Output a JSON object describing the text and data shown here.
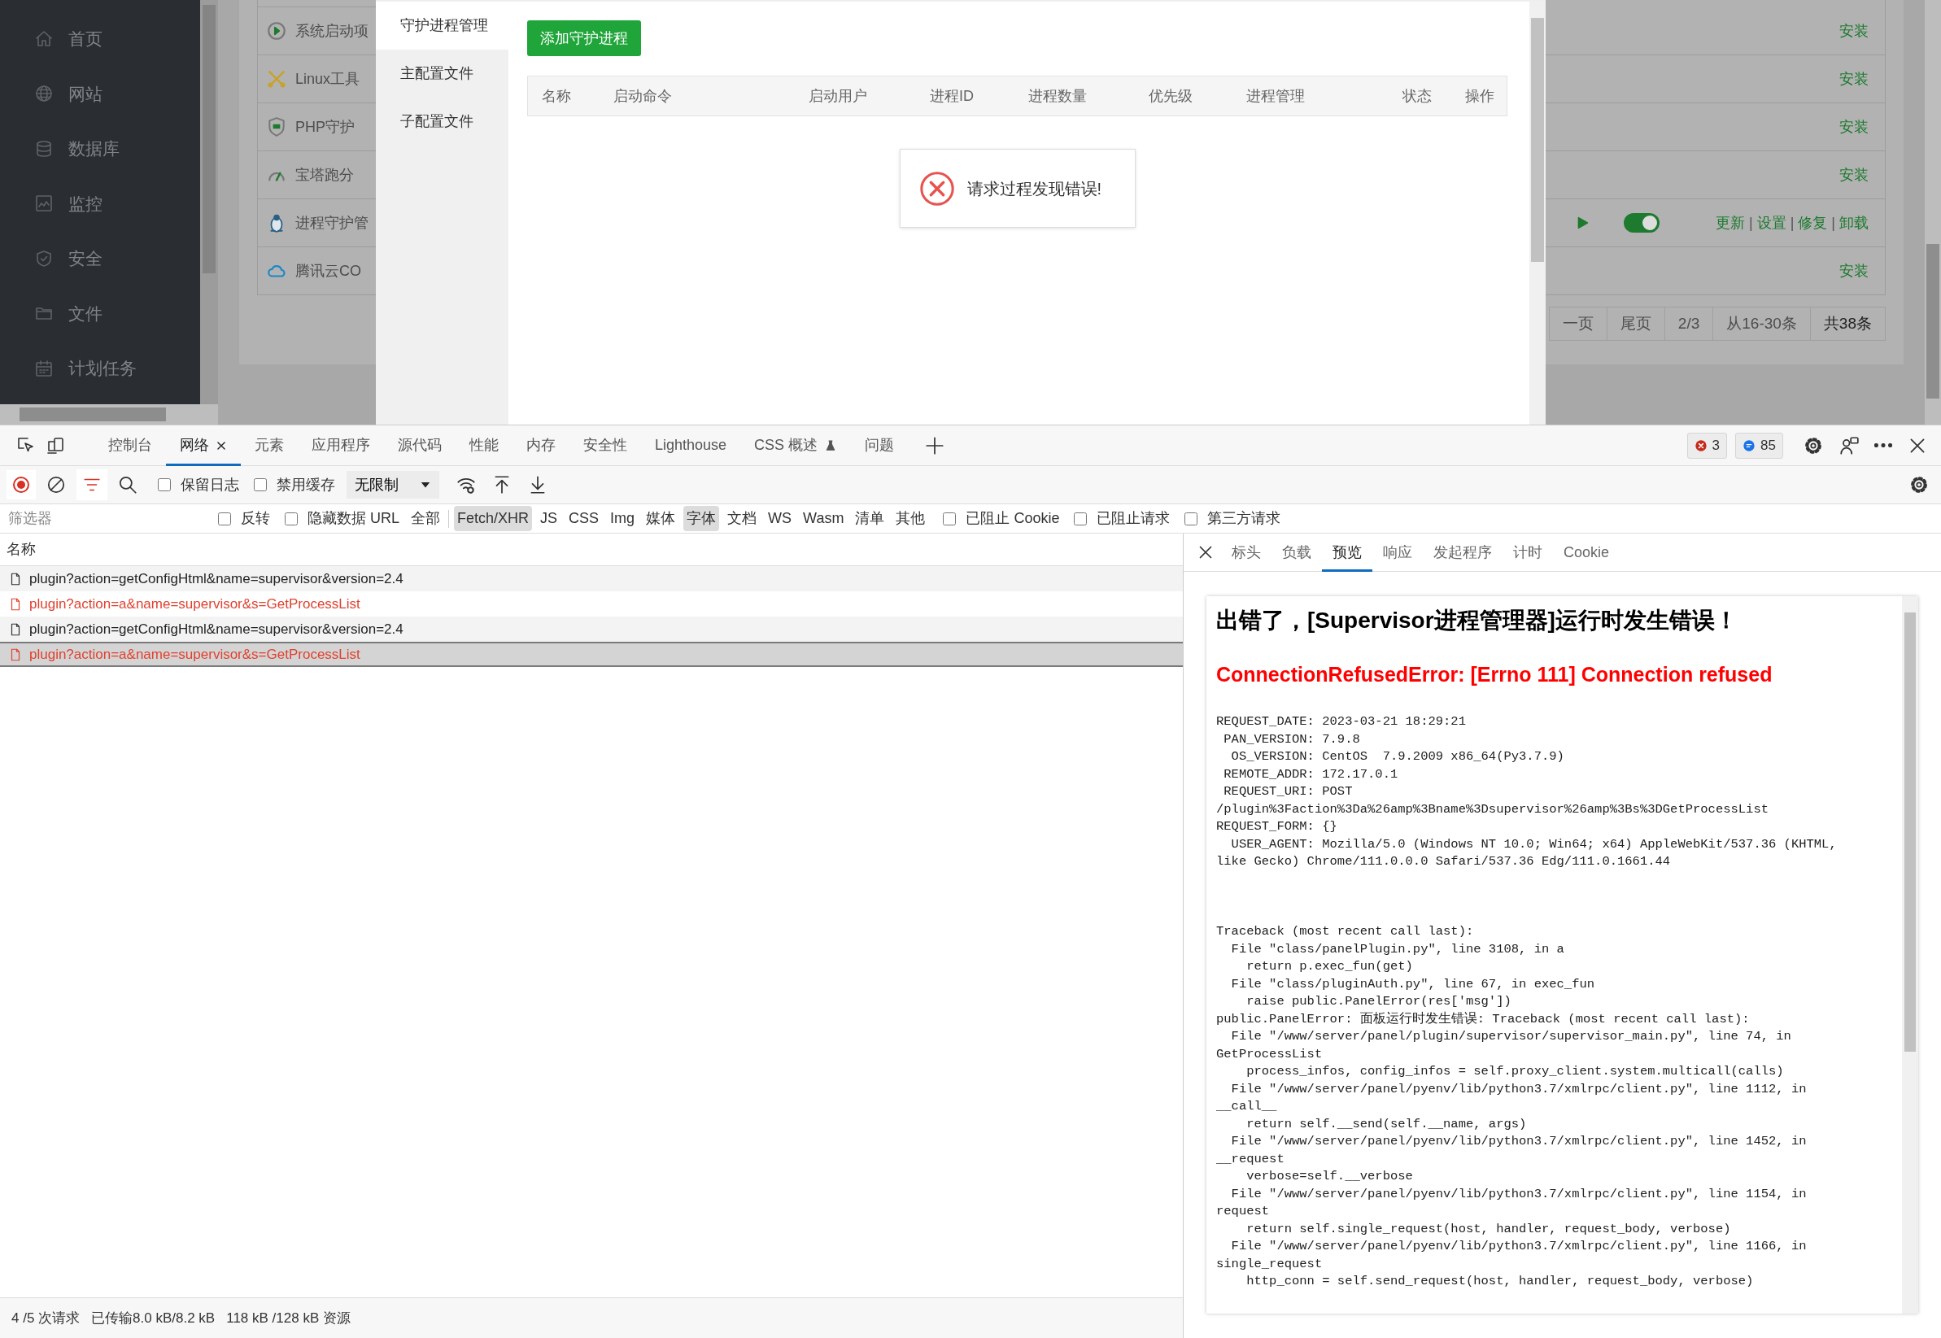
{
  "sidebar": {
    "items": [
      {
        "label": "首页"
      },
      {
        "label": "网站"
      },
      {
        "label": "数据库"
      },
      {
        "label": "监控"
      },
      {
        "label": "安全"
      },
      {
        "label": "文件"
      },
      {
        "label": "计划任务"
      }
    ]
  },
  "plugin_list": {
    "rows": [
      {
        "name": "系统启动项"
      },
      {
        "name": "Linux工具"
      },
      {
        "name": "PHP守护"
      },
      {
        "name": "宝塔跑分"
      },
      {
        "name": "进程守护管"
      },
      {
        "name": "腾讯云CO"
      }
    ]
  },
  "dialog": {
    "tabs": [
      {
        "label": "守护进程管理",
        "selected": true
      },
      {
        "label": "主配置文件",
        "selected": false
      },
      {
        "label": "子配置文件",
        "selected": false
      }
    ],
    "add_button": "添加守护进程",
    "table": {
      "columns": [
        "名称",
        "启动命令",
        "启动用户",
        "进程ID",
        "进程数量",
        "优先级",
        "进程管理",
        "状态",
        "操作"
      ]
    },
    "toast": "请求过程发现错误!"
  },
  "plugin_table": {
    "separator": "|",
    "rows": [
      {
        "kind": "install",
        "action": "安装"
      },
      {
        "kind": "install",
        "action": "安装"
      },
      {
        "kind": "install",
        "action": "安装"
      },
      {
        "kind": "install",
        "action": "安装"
      },
      {
        "kind": "installed",
        "enabled": true,
        "actions": [
          "更新",
          "设置",
          "修复",
          "卸载"
        ]
      },
      {
        "kind": "install",
        "action": "安装"
      }
    ],
    "pager": [
      "一页",
      "尾页",
      "2/3",
      "从16-30条",
      "共38条"
    ]
  },
  "devtools": {
    "tabs": [
      {
        "label": "控制台",
        "selected": false,
        "experimental": false
      },
      {
        "label": "网络",
        "selected": true,
        "experimental": false
      },
      {
        "label": "元素",
        "selected": false,
        "experimental": false
      },
      {
        "label": "应用程序",
        "selected": false,
        "experimental": false
      },
      {
        "label": "源代码",
        "selected": false,
        "experimental": false
      },
      {
        "label": "性能",
        "selected": false,
        "experimental": false
      },
      {
        "label": "内存",
        "selected": false,
        "experimental": false
      },
      {
        "label": "安全性",
        "selected": false,
        "experimental": false
      },
      {
        "label": "Lighthouse",
        "selected": false,
        "experimental": false
      },
      {
        "label": "CSS 概述",
        "selected": false,
        "experimental": true
      },
      {
        "label": "问题",
        "selected": false,
        "experimental": false
      }
    ],
    "errors": "3",
    "messages": "85",
    "toolbar": {
      "recording": true,
      "preserve_log": {
        "label": "保留日志",
        "checked": false
      },
      "disable_cache": {
        "label": "禁用缓存",
        "checked": false
      },
      "throttling": "无限制"
    },
    "filter_bar": {
      "placeholder": "筛选器",
      "invert": {
        "label": "反转",
        "checked": false
      },
      "hide_data_urls": {
        "label": "隐藏数据 URL",
        "checked": false
      },
      "types": [
        {
          "label": "全部",
          "selected": false
        },
        {
          "label": "Fetch/XHR",
          "selected": true
        },
        {
          "label": "JS",
          "selected": false
        },
        {
          "label": "CSS",
          "selected": false
        },
        {
          "label": "Img",
          "selected": false
        },
        {
          "label": "媒体",
          "selected": false
        },
        {
          "label": "字体",
          "selected": true
        },
        {
          "label": "文档",
          "selected": false
        },
        {
          "label": "WS",
          "selected": false
        },
        {
          "label": "Wasm",
          "selected": false
        },
        {
          "label": "清单",
          "selected": false
        },
        {
          "label": "其他",
          "selected": false
        }
      ],
      "blocked_cookies": {
        "label": "已阻止 Cookie",
        "checked": false
      },
      "blocked_requests": {
        "label": "已阻止请求",
        "checked": false
      },
      "third_party": {
        "label": "第三方请求",
        "checked": false
      }
    },
    "requests": {
      "header": "名称",
      "rows": [
        {
          "name": "plugin?action=getConfigHtml&name=supervisor&version=2.4",
          "failed": false,
          "selected": false
        },
        {
          "name": "plugin?action=a&name=supervisor&s=GetProcessList",
          "failed": true,
          "selected": false
        },
        {
          "name": "plugin?action=getConfigHtml&name=supervisor&version=2.4",
          "failed": false,
          "selected": false
        },
        {
          "name": "plugin?action=a&name=supervisor&s=GetProcessList",
          "failed": true,
          "selected": true
        }
      ]
    },
    "status_bar": {
      "requests": "4 /5 次请求",
      "transferred": "已传输8.0 kB/8.2 kB",
      "resources": "118 kB /128 kB 资源"
    },
    "detail": {
      "tabs": [
        {
          "label": "标头",
          "selected": false
        },
        {
          "label": "负载",
          "selected": false
        },
        {
          "label": "预览",
          "selected": true
        },
        {
          "label": "响应",
          "selected": false
        },
        {
          "label": "发起程序",
          "selected": false
        },
        {
          "label": "计时",
          "selected": false
        },
        {
          "label": "Cookie",
          "selected": false
        }
      ],
      "preview": {
        "title": "出错了，[Supervisor进程管理器]运行时发生错误！",
        "error": "ConnectionRefusedError: [Errno 111] Connection refused",
        "lines": [
          "REQUEST_DATE: 2023-03-21 18:29:21",
          " PAN_VERSION: 7.9.8",
          "  OS_VERSION: CentOS  7.9.2009 x86_64(Py3.7.9)",
          " REMOTE_ADDR: 172.17.0.1",
          " REQUEST_URI: POST",
          "/plugin%3Faction%3Da%26amp%3Bname%3Dsupervisor%26amp%3Bs%3DGetProcessList",
          "REQUEST_FORM: {}",
          "  USER_AGENT: Mozilla/5.0 (Windows NT 10.0; Win64; x64) AppleWebKit/537.36 (KHTML,",
          "like Gecko) Chrome/111.0.0.0 Safari/537.36 Edg/111.0.1661.44"
        ],
        "traceback": [
          "Traceback (most recent call last):",
          "  File \"class/panelPlugin.py\", line 3108, in a",
          "    return p.exec_fun(get)",
          "  File \"class/pluginAuth.py\", line 67, in exec_fun",
          "    raise public.PanelError(res['msg'])",
          "public.PanelError: 面板运行时发生错误: Traceback (most recent call last):",
          "  File \"/www/server/panel/plugin/supervisor/supervisor_main.py\", line 74, in",
          "GetProcessList",
          "    process_infos, config_infos = self.proxy_client.system.multicall(calls)",
          "  File \"/www/server/panel/pyenv/lib/python3.7/xmlrpc/client.py\", line 1112, in",
          "__call__",
          "    return self.__send(self.__name, args)",
          "  File \"/www/server/panel/pyenv/lib/python3.7/xmlrpc/client.py\", line 1452, in",
          "__request",
          "    verbose=self.__verbose",
          "  File \"/www/server/panel/pyenv/lib/python3.7/xmlrpc/client.py\", line 1154, in",
          "request",
          "    return self.single_request(host, handler, request_body, verbose)",
          "  File \"/www/server/panel/pyenv/lib/python3.7/xmlrpc/client.py\", line 1166, in",
          "single_request",
          "    http_conn = self.send_request(host, handler, request_body, verbose)"
        ]
      }
    }
  }
}
